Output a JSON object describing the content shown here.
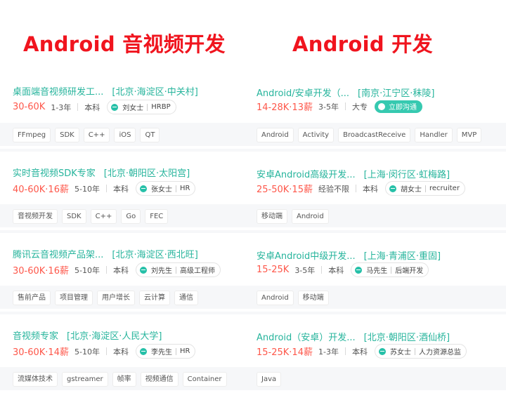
{
  "headings": {
    "left": "Android 音视频开发",
    "right": "Android 开发"
  },
  "left_jobs": [
    {
      "title": "桌面端音视频研发工...",
      "area": "[北京·海淀区·中关村]",
      "salary": "30-60K",
      "exp": "1-3年",
      "edu": "本科",
      "recruiter_name": "刘女士",
      "recruiter_role": "HRBP",
      "tags": [
        "FFmpeg",
        "SDK",
        "C++",
        "iOS",
        "QT"
      ]
    },
    {
      "title": "实时音视频SDK专家",
      "area": "[北京·朝阳区·太阳宫]",
      "salary": "40-60K·16薪",
      "exp": "5-10年",
      "edu": "本科",
      "recruiter_name": "张女士",
      "recruiter_role": "HR",
      "tags": [
        "音视频开发",
        "SDK",
        "C++",
        "Go",
        "FEC"
      ]
    },
    {
      "title": "腾讯云音视频产品架...",
      "area": "[北京·海淀区·西北旺]",
      "salary": "30-60K·16薪",
      "exp": "5-10年",
      "edu": "本科",
      "recruiter_name": "刘先生",
      "recruiter_role": "高级工程师",
      "tags": [
        "售前产品",
        "项目管理",
        "用户增长",
        "云计算",
        "通信"
      ]
    },
    {
      "title": "音视频专家",
      "area": "[北京·海淀区·人民大学]",
      "salary": "30-60K·14薪",
      "exp": "5-10年",
      "edu": "本科",
      "recruiter_name": "李先生",
      "recruiter_role": "HR",
      "tags": [
        "流媒体技术",
        "gstreamer",
        "帧率",
        "视频通信",
        "Container"
      ]
    }
  ],
  "right_jobs": [
    {
      "title": "Android/安卓开发（...",
      "area": "[南京·江宁区·秣陵]",
      "salary": "14-28K·13薪",
      "exp": "3-5年",
      "edu": "大专",
      "im_label": "立即沟通",
      "tags": [
        "Android",
        "Activity",
        "BroadcastReceive",
        "Handler",
        "MVP"
      ]
    },
    {
      "title": "安卓Android高级开发...",
      "area": "[上海·闵行区·虹梅路]",
      "salary": "25-50K·15薪",
      "exp": "经验不限",
      "edu": "本科",
      "recruiter_name": "胡女士",
      "recruiter_role": "recruiter",
      "tags": [
        "移动端",
        "Android"
      ]
    },
    {
      "title": "安卓Android中级开发...",
      "area": "[上海·青浦区·重固]",
      "salary": "15-25K",
      "exp": "3-5年",
      "edu": "本科",
      "recruiter_name": "马先生",
      "recruiter_role": "后端开发",
      "tags": [
        "Android",
        "移动端"
      ]
    },
    {
      "title": "Android（安卓）开发...",
      "area": "[北京·朝阳区·酒仙桥]",
      "salary": "15-25K·14薪",
      "exp": "1-3年",
      "edu": "本科",
      "recruiter_name": "苏女士",
      "recruiter_role": "人力资源总监",
      "tags": [
        "Java"
      ]
    }
  ],
  "colors": {
    "accent_teal": "#26b49c",
    "salary_red": "#fe574a",
    "heading_red": "#f0141e",
    "im_button": "#36c9b0"
  }
}
